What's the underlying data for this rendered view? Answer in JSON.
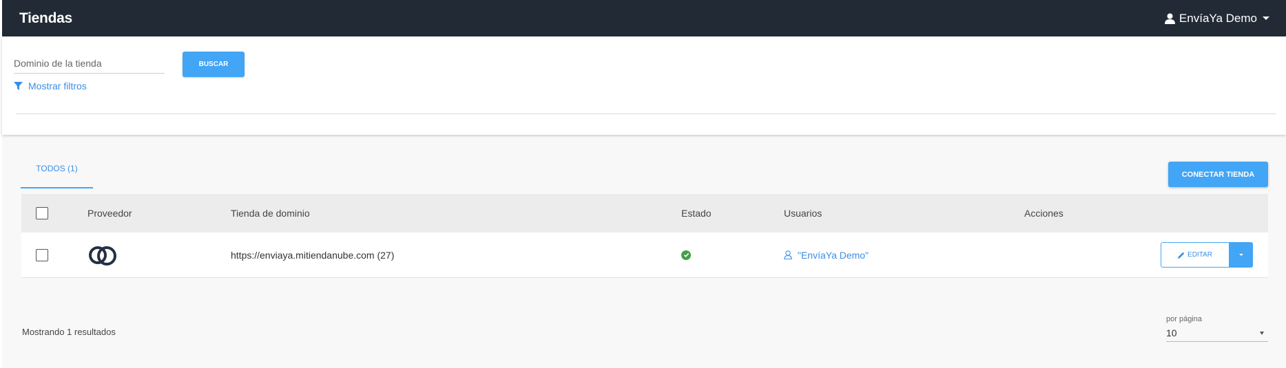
{
  "navbar": {
    "title": "Tiendas",
    "user_name": "EnvíaYa Demo"
  },
  "search": {
    "placeholder": "Dominio de la tienda",
    "button_label": "BUSCAR",
    "filters_label": "Mostrar filtros"
  },
  "tabs": [
    {
      "label": "TODOS (1)",
      "active": true
    }
  ],
  "connect_button_label": "CONECTAR TIENDA",
  "table": {
    "columns": [
      "Proveedor",
      "Tienda de dominio",
      "Estado",
      "Usuarios",
      "Acciones"
    ],
    "rows": [
      {
        "provider_icon": "tiendanube-logo-icon",
        "domain": "https://enviaya.mitiendanube.com (27)",
        "status_icon": "check-circle-icon",
        "user": "\"EnvíaYa Demo\"",
        "edit_label": "EDITAR"
      }
    ]
  },
  "footer": {
    "results_text": "Mostrando 1 resultados",
    "per_page_label": "por página",
    "per_page_value": "10"
  },
  "colors": {
    "navbar": "#222b35",
    "primary": "#42a5f5",
    "link": "#3a8ee6",
    "success": "#43a047"
  }
}
